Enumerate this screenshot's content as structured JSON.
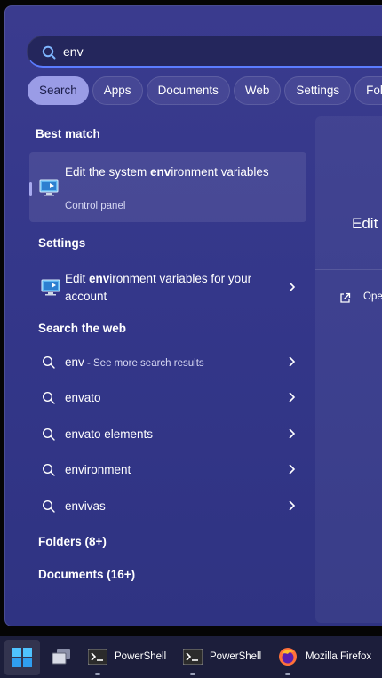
{
  "search": {
    "query": "env",
    "icon": "search-icon"
  },
  "filters": [
    {
      "label": "Search",
      "active": true
    },
    {
      "label": "Apps"
    },
    {
      "label": "Documents"
    },
    {
      "label": "Web"
    },
    {
      "label": "Settings"
    },
    {
      "label": "Folder"
    }
  ],
  "best_match": {
    "heading": "Best match",
    "title_pre": "Edit the system ",
    "title_bold": "env",
    "title_post": "ironment variables",
    "subtitle": "Control panel",
    "icon": "control-panel-icon"
  },
  "settings": {
    "heading": "Settings",
    "item": {
      "pre": "Edit ",
      "bold": "env",
      "post": "ironment variables for your account"
    }
  },
  "web": {
    "heading": "Search the web",
    "items": [
      {
        "query": "env",
        "suffix": " - See more search results"
      },
      {
        "query": "envato"
      },
      {
        "query": "envato elements"
      },
      {
        "query": "environment"
      },
      {
        "query": "envivas"
      }
    ]
  },
  "folders_heading": "Folders (8+)",
  "documents_heading": "Documents (16+)",
  "preview": {
    "title": "Edit",
    "open_label": "Ope"
  },
  "taskbar": {
    "items": [
      {
        "label": "PowerShell"
      },
      {
        "label": "PowerShell"
      },
      {
        "label": "Mozilla Firefox"
      }
    ]
  },
  "colors": {
    "panel": "#3a3b8e",
    "accent": "#9a9ce6",
    "taskbar": "#1c1e3b"
  }
}
